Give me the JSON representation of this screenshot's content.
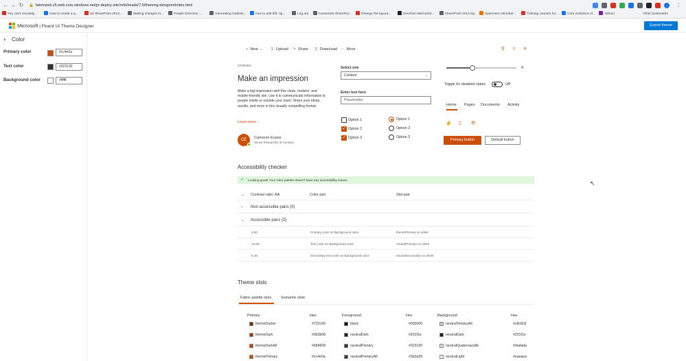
{
  "browser": {
    "url": "fabricweb.z5.web.core.windows.net/pr-deploy-site/refs/heads/7.0/theming-designer/index.html",
    "bookmarks": [
      {
        "label": "You can't remotely...",
        "color": "#d93025"
      },
      {
        "label": "How to create a q...",
        "color": "#1a73e8"
      },
      {
        "label": "(6) SharePoint 2013...",
        "color": "#d93025"
      },
      {
        "label": "Making changes to...",
        "color": "#5f6368"
      },
      {
        "label": "People Directory -...",
        "color": "#5f6368"
      },
      {
        "label": "Generating Outlook...",
        "color": "#5f6368"
      },
      {
        "label": "how to add left, rig...",
        "color": "#1a73e8"
      },
      {
        "label": "Log out",
        "color": "#5f6368"
      },
      {
        "label": "Customize SharePoi...",
        "color": "#5f6368"
      },
      {
        "label": "Change the layout...",
        "color": "#d93025"
      },
      {
        "label": "Sencheri-site/css/st...",
        "color": "#202124"
      },
      {
        "label": "SharePoint 2013 sty...",
        "color": "#5f6368"
      },
      {
        "label": "SpamHero Member...",
        "color": "#e37400"
      },
      {
        "label": "Training courses for...",
        "color": "#d93025"
      },
      {
        "label": "Core Solutions of...",
        "color": "#1a73e8"
      },
      {
        "label": "Yahoo!",
        "color": "#7b1fa2"
      }
    ],
    "other_bookmarks": "Other bookmarks"
  },
  "app": {
    "brand": "Microsoft",
    "title": "| Fluent UI Theme Designer",
    "export_label": "Export theme"
  },
  "left": {
    "heading": "Color",
    "primary_label": "Primary color",
    "primary_value": "#cc4e0a",
    "text_label": "Text color",
    "text_value": "#323130",
    "background_label": "Background color",
    "background_value": "#ffffff"
  },
  "toolbar": {
    "new": "New",
    "upload": "Upload",
    "share": "Share",
    "download": "Download",
    "more": "More"
  },
  "story": {
    "eyebrow": "STORIES",
    "title": "Make an impression",
    "body": "Make a big impression with this clean, modern, and mobile-friendly site. Use it to communicate information to people inside or outside your team. Share your ideas, results, and more in this visually compelling format.",
    "learn_more": "Learn more",
    "persona_initials": "CE",
    "persona_name": "Cameron Evans",
    "persona_role": "Senior Researcher at Contoso"
  },
  "form": {
    "select_label": "Select one",
    "select_value": "Content",
    "text_label": "Enter text here",
    "text_placeholder": "Placeholder",
    "checkboxes": [
      {
        "label": "Option 1",
        "checked": false
      },
      {
        "label": "Option 2",
        "checked": true
      },
      {
        "label": "Option 3",
        "checked": true
      }
    ],
    "radios": [
      {
        "label": "Option 1",
        "selected": true
      },
      {
        "label": "Option 2",
        "selected": false
      },
      {
        "label": "Option 3",
        "selected": false
      }
    ]
  },
  "controls": {
    "slider_value": "4",
    "slider_fraction": 0.37,
    "toggle_label": "Toggle for disabled states",
    "toggle_state": "Off",
    "pivot": [
      "Home",
      "Pages",
      "Documents",
      "Activity"
    ],
    "primary_button": "Primary button",
    "default_button": "Default button"
  },
  "accessibility": {
    "heading": "Accessibility checker",
    "message": "Looking good! Your color palette doesn't have any accessibility issues.",
    "col_ratio": "Contrast ratio: AA",
    "col_pair": "Color pair",
    "col_slot": "Slot pair",
    "non_accessible": "Non accessible pairs (0)",
    "accessible": "Accessible pairs (3)",
    "rows": [
      {
        "ratio": "4.50",
        "pair": "Primary color on Background color",
        "slot": "themePrimary on white"
      },
      {
        "ratio": "12.06",
        "pair": "Text color on Background color",
        "slot": "neutralPrimary on white"
      },
      {
        "ratio": "6.46",
        "pair": "Secondary text color on Background color",
        "slot": "neutralSecondary on white"
      }
    ]
  },
  "slots": {
    "heading": "Theme slots",
    "tabs": [
      "Fabric palette slots",
      "Semantic slots"
    ],
    "columns": [
      "Primary",
      "Hex",
      "Foreground",
      "Hex",
      "Background",
      "Hex"
    ],
    "rows": [
      {
        "p_name": "themeDarker",
        "p_color": "#722c06",
        "p_hex": "#722c06",
        "f_name": "black",
        "f_color": "#000000",
        "f_hex": "#000000",
        "b_name": "neutralTertiaryAlt",
        "b_color": "#c8c8c8",
        "b_hex": "#c8c8c8"
      },
      {
        "p_name": "themeDark",
        "p_color": "#9b3b08",
        "p_hex": "#9b3b08",
        "f_name": "neutralDark",
        "f_color": "#201f1e",
        "f_hex": "#201f1e",
        "b_name": "neutralDark",
        "b_color": "#201f1e",
        "b_hex": "#201f1e"
      },
      {
        "p_name": "themeDarkAlt",
        "p_color": "#b84609",
        "p_hex": "#b84609",
        "f_name": "neutralPrimary",
        "f_color": "#323130",
        "f_hex": "#323130",
        "b_name": "neutralQuaternaryAlt",
        "b_color": "#dadada",
        "b_hex": "#dadada"
      },
      {
        "p_name": "themePrimary",
        "p_color": "#cc4e0a",
        "p_hex": "#cc4e0a",
        "f_name": "neutralPrimaryAlt",
        "f_color": "#3b3a39",
        "f_hex": "#3b3a39",
        "b_name": "neutralLight",
        "b_color": "#eaeaea",
        "b_hex": "#eaeaea"
      }
    ]
  }
}
